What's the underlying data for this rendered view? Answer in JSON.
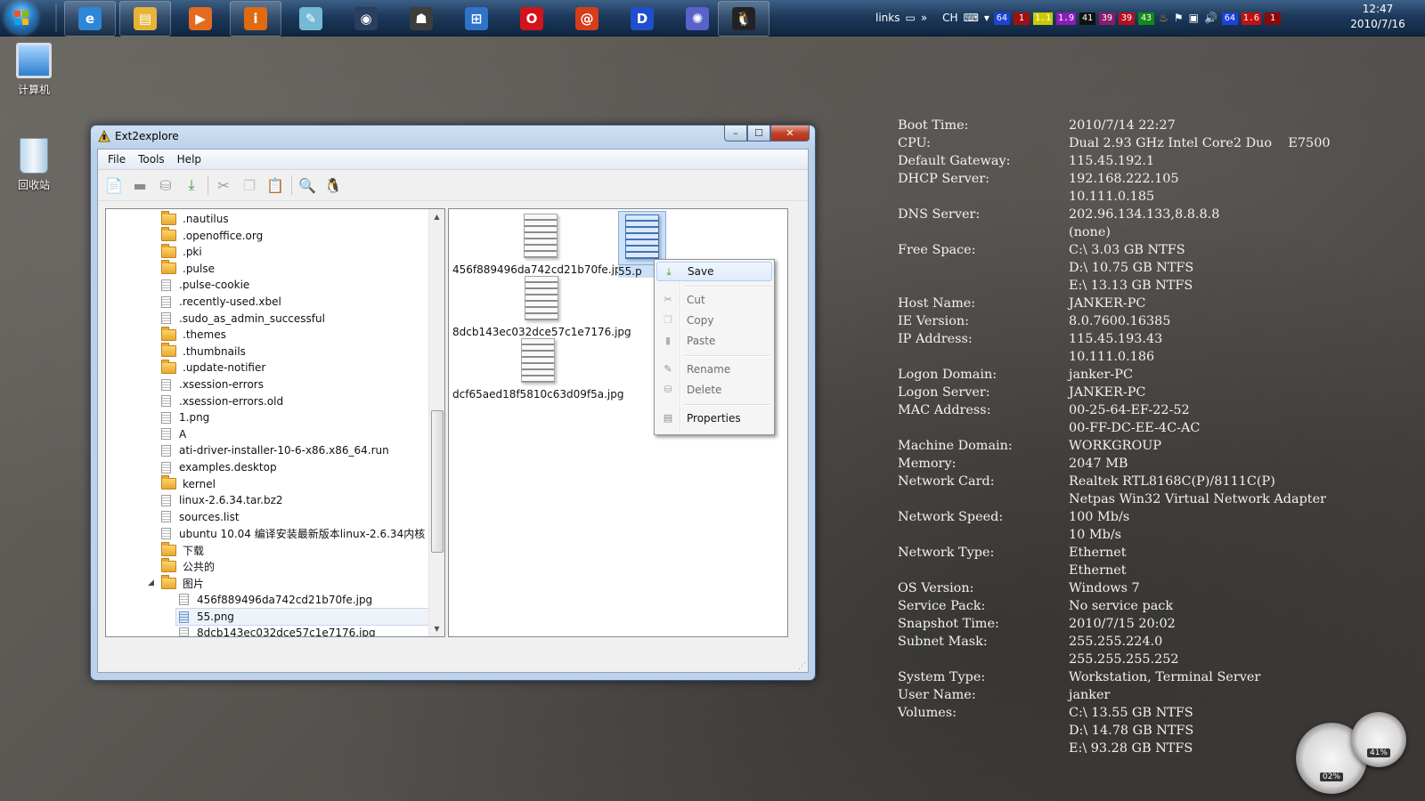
{
  "taskbar": {
    "pinned": [
      {
        "name": "internet-explorer-icon",
        "glyph": "e",
        "color": "#2d87d6"
      },
      {
        "name": "explorer-folder-icon",
        "glyph": "▤",
        "color": "#e7b437"
      },
      {
        "name": "media-player-icon",
        "glyph": "▶",
        "color": "#e46b1e"
      },
      {
        "name": "info-icon",
        "glyph": "i",
        "color": "#e06a10"
      },
      {
        "name": "notepad-icon",
        "glyph": "✎",
        "color": "#76b9d6"
      },
      {
        "name": "eye-app-icon",
        "glyph": "◉",
        "color": "#2a3e5e"
      },
      {
        "name": "cat-app-icon",
        "glyph": "☗",
        "color": "#3d3d3d"
      },
      {
        "name": "windows-flag-icon",
        "glyph": "⊞",
        "color": "#2f73c9"
      },
      {
        "name": "opera-icon",
        "glyph": "O",
        "color": "#d2131a"
      },
      {
        "name": "swirl-app-icon",
        "glyph": "@",
        "color": "#d63d1b"
      },
      {
        "name": "d-app-icon",
        "glyph": "D",
        "color": "#1f4fcb"
      },
      {
        "name": "flower-app-icon",
        "glyph": "✺",
        "color": "#5a62c9"
      },
      {
        "name": "tux-taskbar-icon",
        "glyph": "🐧",
        "color": "#222222"
      }
    ],
    "tray": {
      "links_label": "links",
      "lang": "CH",
      "badges": [
        {
          "text": "64",
          "bg": "#1c43d6"
        },
        {
          "text": "1",
          "bg": "#a01010"
        },
        {
          "text": "1.1",
          "bg": "#c9c900"
        },
        {
          "text": "1.9",
          "bg": "#8a1db8"
        },
        {
          "text": "41",
          "bg": "#111111"
        },
        {
          "text": "39",
          "bg": "#8d1a6e"
        },
        {
          "text": "39",
          "bg": "#b80e22"
        },
        {
          "text": "43",
          "bg": "#118a18"
        }
      ],
      "badges2": [
        {
          "text": "64",
          "bg": "#1c43d6"
        },
        {
          "text": "1.6",
          "bg": "#c01111"
        },
        {
          "text": "1",
          "bg": "#8a0a0a"
        }
      ]
    },
    "clock": {
      "time": "12:47",
      "date": "2010/7/16"
    }
  },
  "desktop_icons": [
    {
      "label": "计算机"
    },
    {
      "label": "回收站"
    }
  ],
  "window": {
    "title": "Ext2explore",
    "caption_buttons": {
      "minimize": "–",
      "maximize": "☐",
      "close": "✕"
    },
    "menu": [
      "File",
      "Tools",
      "Help"
    ],
    "toolbar": [
      {
        "name": "new-file-icon",
        "glyph": "📄",
        "color": "#c8b15e"
      },
      {
        "name": "folder-icon",
        "glyph": "▬",
        "color": "#8b8b8b"
      },
      {
        "name": "trash-icon",
        "glyph": "⛁",
        "color": "#a4a4a4"
      },
      {
        "name": "save-icon",
        "glyph": "⤓",
        "color": "#2c9a2c"
      },
      {
        "sep": true
      },
      {
        "name": "cut-icon",
        "glyph": "✂",
        "color": "#9a9a9a"
      },
      {
        "name": "copy-icon",
        "glyph": "❐",
        "color": "#c6c6c6"
      },
      {
        "name": "paste-icon",
        "glyph": "📋",
        "color": "#bdbdbd"
      },
      {
        "sep": true
      },
      {
        "name": "find-disk-icon",
        "glyph": "🔍",
        "color": "#3d6fb0"
      },
      {
        "name": "tux-icon",
        "glyph": "🐧",
        "color": "#222222"
      }
    ],
    "tree": {
      "nodes": [
        {
          "label": ".nautilus",
          "type": "folder"
        },
        {
          "label": ".openoffice.org",
          "type": "folder"
        },
        {
          "label": ".pki",
          "type": "folder"
        },
        {
          "label": ".pulse",
          "type": "folder"
        },
        {
          "label": ".pulse-cookie",
          "type": "file"
        },
        {
          "label": ".recently-used.xbel",
          "type": "file"
        },
        {
          "label": ".sudo_as_admin_successful",
          "type": "file"
        },
        {
          "label": ".themes",
          "type": "folder"
        },
        {
          "label": ".thumbnails",
          "type": "folder"
        },
        {
          "label": ".update-notifier",
          "type": "folder"
        },
        {
          "label": ".xsession-errors",
          "type": "file"
        },
        {
          "label": ".xsession-errors.old",
          "type": "file"
        },
        {
          "label": "1.png",
          "type": "file"
        },
        {
          "label": "A",
          "type": "file"
        },
        {
          "label": "ati-driver-installer-10-6-x86.x86_64.run",
          "type": "file"
        },
        {
          "label": "examples.desktop",
          "type": "file"
        },
        {
          "label": "kernel",
          "type": "folder"
        },
        {
          "label": "linux-2.6.34.tar.bz2",
          "type": "file"
        },
        {
          "label": "sources.list",
          "type": "file"
        },
        {
          "label": "ubuntu 10.04 编译安装最新版本linux-2.6.34内核",
          "type": "file"
        },
        {
          "label": "下载",
          "type": "folder"
        },
        {
          "label": "公共的",
          "type": "folder"
        },
        {
          "label": "图片",
          "type": "folder",
          "expanded": true
        },
        {
          "label": "456f889496da742cd21b70fe.jpg",
          "type": "file",
          "child": true
        },
        {
          "label": "55.png",
          "type": "file",
          "child": true,
          "selected": true
        },
        {
          "label": "8dcb143ec032dce57c1e7176.jpg",
          "type": "file",
          "child": true
        }
      ]
    },
    "files": [
      {
        "label": "456f889496da742cd21b70fe.jpg"
      },
      {
        "label": "55.png",
        "display": "55.p",
        "selected": true
      },
      {
        "label": "8dcb143ec032dce57c1e7176.jpg"
      },
      {
        "label": "dcf65aed18f5810c63d09f5a.jpg"
      }
    ],
    "context_menu": [
      {
        "label": "Save",
        "icon": "save-icon",
        "glyph": "⤓",
        "color": "#2c9a2c",
        "highlighted": true
      },
      {
        "sep": true
      },
      {
        "label": "Cut",
        "icon": "cut-icon",
        "glyph": "✂",
        "color": "#a0a0a0",
        "disabled": true
      },
      {
        "label": "Copy",
        "icon": "copy-icon",
        "glyph": "❐",
        "color": "#c6c6c6",
        "disabled": true
      },
      {
        "label": "Paste",
        "icon": "paste-icon",
        "glyph": "▮",
        "color": "#b0b0b0",
        "disabled": true
      },
      {
        "sep": true
      },
      {
        "label": "Rename",
        "icon": "rename-icon",
        "glyph": "✎",
        "color": "#909090",
        "disabled": true
      },
      {
        "label": "Delete",
        "icon": "trash-icon",
        "glyph": "⛁",
        "color": "#a4a4a4",
        "disabled": true
      },
      {
        "sep": true
      },
      {
        "label": "Properties",
        "icon": "properties-icon",
        "glyph": "▤",
        "color": "#8a8a8a"
      }
    ]
  },
  "sysinfo": [
    {
      "k": "Boot Time:",
      "v": "2010/7/14 22:27"
    },
    {
      "k": "CPU:",
      "v": "Dual 2.93 GHz Intel Core2 Duo    E7500"
    },
    {
      "k": "Default Gateway:",
      "v": "115.45.192.1"
    },
    {
      "k": "DHCP Server:",
      "v": "192.168.222.105"
    },
    {
      "k": "",
      "v": "10.111.0.185"
    },
    {
      "k": "DNS Server:",
      "v": "202.96.134.133,8.8.8.8"
    },
    {
      "k": "",
      "v": "(none)"
    },
    {
      "k": "Free Space:",
      "v": "C:\\ 3.03 GB NTFS"
    },
    {
      "k": "",
      "v": "D:\\ 10.75 GB NTFS"
    },
    {
      "k": "",
      "v": "E:\\ 13.13 GB NTFS"
    },
    {
      "k": "Host Name:",
      "v": "JANKER-PC"
    },
    {
      "k": "IE Version:",
      "v": "8.0.7600.16385"
    },
    {
      "k": "IP Address:",
      "v": "115.45.193.43"
    },
    {
      "k": "",
      "v": "10.111.0.186"
    },
    {
      "k": "Logon Domain:",
      "v": "janker-PC"
    },
    {
      "k": "Logon Server:",
      "v": "JANKER-PC"
    },
    {
      "k": "MAC Address:",
      "v": "00-25-64-EF-22-52"
    },
    {
      "k": "",
      "v": "00-FF-DC-EE-4C-AC"
    },
    {
      "k": "Machine Domain:",
      "v": "WORKGROUP"
    },
    {
      "k": "Memory:",
      "v": "2047 MB"
    },
    {
      "k": "Network Card:",
      "v": "Realtek RTL8168C(P)/8111C(P)"
    },
    {
      "k": "",
      "v": "Netpas Win32 Virtual Network Adapter"
    },
    {
      "k": "Network Speed:",
      "v": "100 Mb/s"
    },
    {
      "k": "",
      "v": "10 Mb/s"
    },
    {
      "k": "Network Type:",
      "v": "Ethernet"
    },
    {
      "k": "",
      "v": "Ethernet"
    },
    {
      "k": "OS Version:",
      "v": "Windows 7"
    },
    {
      "k": "Service Pack:",
      "v": "No service pack"
    },
    {
      "k": "Snapshot Time:",
      "v": "2010/7/15 20:02"
    },
    {
      "k": "Subnet Mask:",
      "v": "255.255.224.0"
    },
    {
      "k": "",
      "v": "255.255.255.252"
    },
    {
      "k": "System Type:",
      "v": "Workstation, Terminal Server"
    },
    {
      "k": "User Name:",
      "v": "janker"
    },
    {
      "k": "Volumes:",
      "v": "C:\\ 13.55 GB NTFS"
    },
    {
      "k": "",
      "v": "D:\\ 14.78 GB NTFS"
    },
    {
      "k": "",
      "v": "E:\\ 93.28 GB NTFS"
    }
  ],
  "gadget": {
    "cpu_pct": "02%",
    "mem_pct": "41%"
  }
}
